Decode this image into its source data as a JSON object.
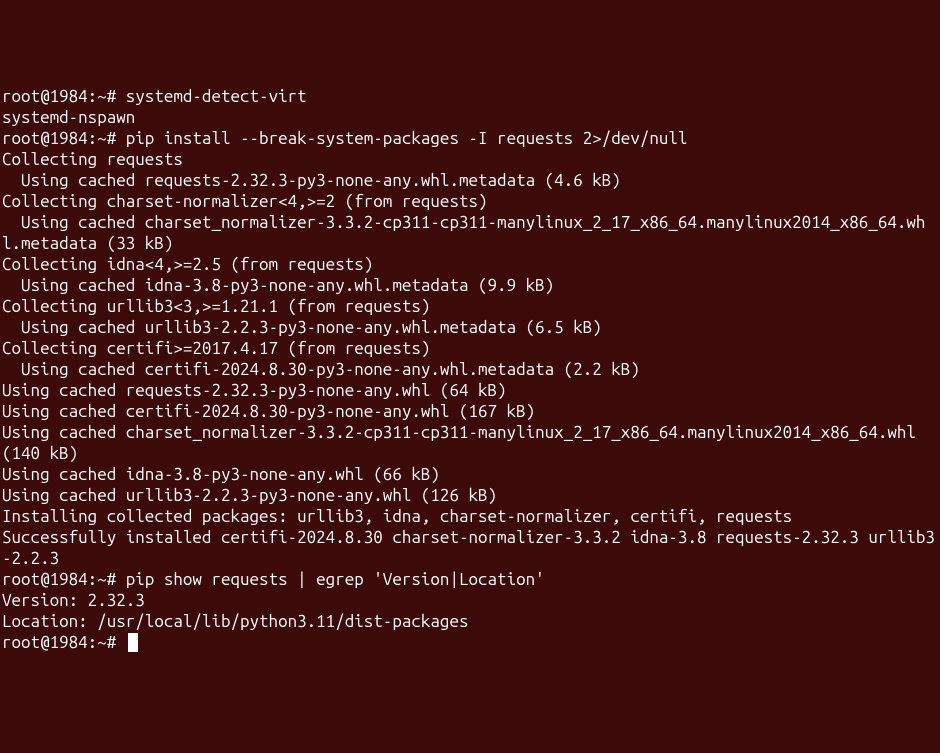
{
  "prompt": "root@1984:~# ",
  "commands": {
    "cmd1": "systemd-detect-virt",
    "cmd2": "pip install --break-system-packages -I requests 2>/dev/null",
    "cmd3": "pip show requests | egrep 'Version|Location'"
  },
  "output": {
    "line1": "systemd-nspawn",
    "line2": "Collecting requests",
    "line3": "  Using cached requests-2.32.3-py3-none-any.whl.metadata (4.6 kB)",
    "line4": "Collecting charset-normalizer<4,>=2 (from requests)",
    "line5": "  Using cached charset_normalizer-3.3.2-cp311-cp311-manylinux_2_17_x86_64.manylinux2014_x86_64.whl.metadata (33 kB)",
    "line6": "Collecting idna<4,>=2.5 (from requests)",
    "line7": "  Using cached idna-3.8-py3-none-any.whl.metadata (9.9 kB)",
    "line8": "Collecting urllib3<3,>=1.21.1 (from requests)",
    "line9": "  Using cached urllib3-2.2.3-py3-none-any.whl.metadata (6.5 kB)",
    "line10": "Collecting certifi>=2017.4.17 (from requests)",
    "line11": "  Using cached certifi-2024.8.30-py3-none-any.whl.metadata (2.2 kB)",
    "line12": "Using cached requests-2.32.3-py3-none-any.whl (64 kB)",
    "line13": "Using cached certifi-2024.8.30-py3-none-any.whl (167 kB)",
    "line14": "Using cached charset_normalizer-3.3.2-cp311-cp311-manylinux_2_17_x86_64.manylinux2014_x86_64.whl (140 kB)",
    "line15": "Using cached idna-3.8-py3-none-any.whl (66 kB)",
    "line16": "Using cached urllib3-2.2.3-py3-none-any.whl (126 kB)",
    "line17": "Installing collected packages: urllib3, idna, charset-normalizer, certifi, requests",
    "line18": "Successfully installed certifi-2024.8.30 charset-normalizer-3.3.2 idna-3.8 requests-2.32.3 urllib3-2.2.3",
    "line19": "Version: 2.32.3",
    "line20": "Location: /usr/local/lib/python3.11/dist-packages"
  }
}
